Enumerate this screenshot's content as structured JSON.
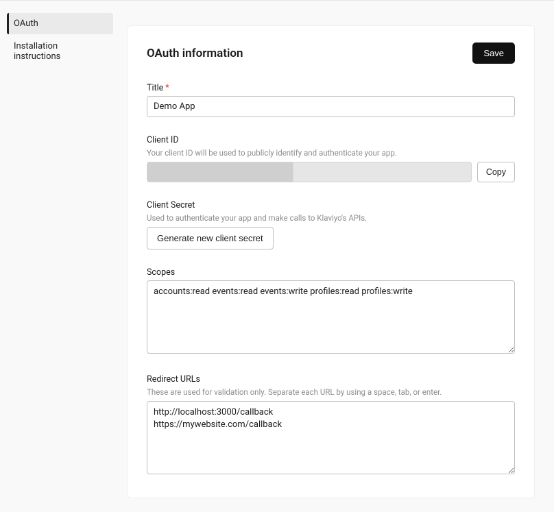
{
  "sidebar": {
    "items": [
      {
        "label": "OAuth"
      },
      {
        "label": "Installation instructions"
      }
    ]
  },
  "header": {
    "title": "OAuth information",
    "save_label": "Save"
  },
  "fields": {
    "title": {
      "label": "Title",
      "value": "Demo App"
    },
    "client_id": {
      "label": "Client ID",
      "help": "Your client ID will be used to publicly identify and authenticate your app.",
      "copy_label": "Copy"
    },
    "client_secret": {
      "label": "Client Secret",
      "help": "Used to authenticate your app and make calls to Klaviyo's APIs.",
      "generate_label": "Generate new client secret"
    },
    "scopes": {
      "label": "Scopes",
      "value": "accounts:read events:read events:write profiles:read profiles:write"
    },
    "redirect_urls": {
      "label": "Redirect URLs",
      "help": "These are used for validation only. Separate each URL by using a space, tab, or enter.",
      "value": "http://localhost:3000/callback\nhttps://mywebsite.com/callback"
    }
  }
}
